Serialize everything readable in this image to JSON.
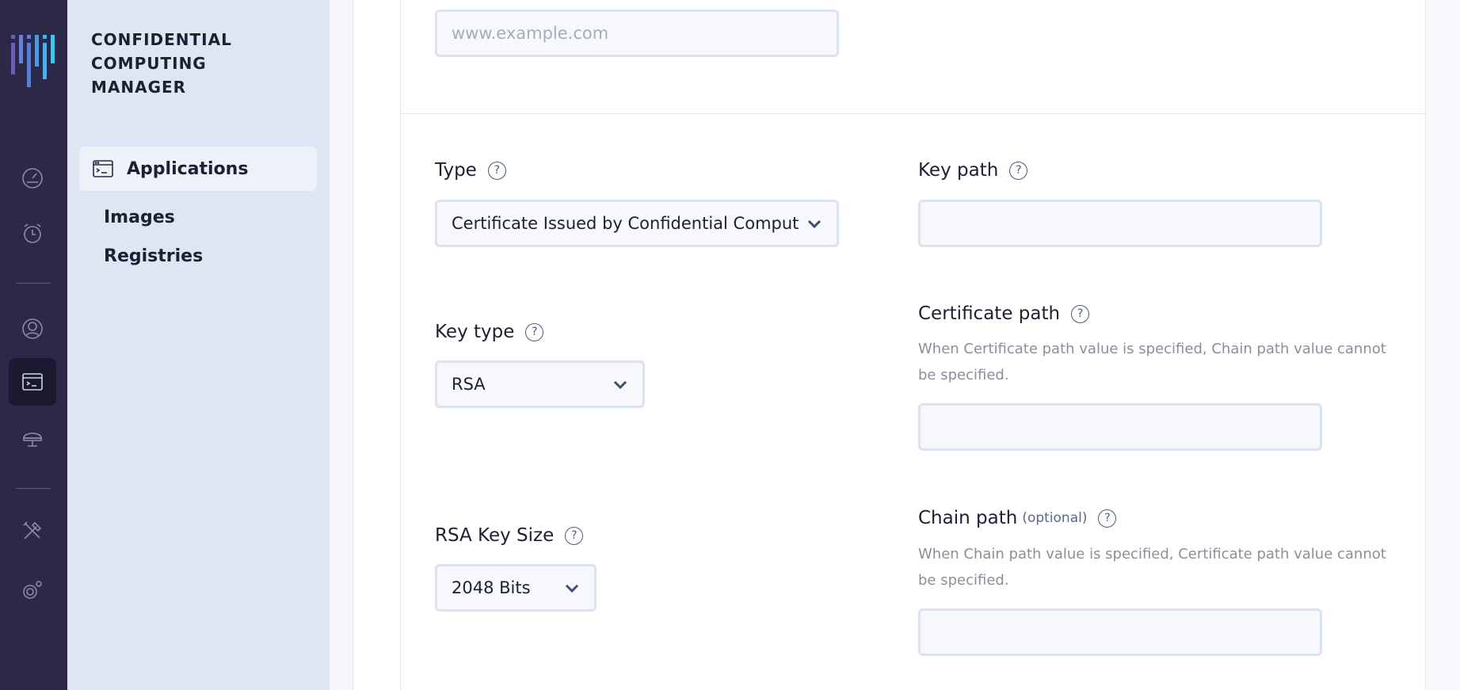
{
  "brand": {
    "line1": "CONFIDENTIAL",
    "line2": "COMPUTING",
    "line3": "MANAGER"
  },
  "rail_icons": [
    "dashboard-icon",
    "alarm-icon",
    "user-support-icon",
    "terminal-icon",
    "router-icon",
    "tools-icon",
    "settings-icon"
  ],
  "nav": {
    "items": [
      {
        "label": "Applications",
        "active": true
      },
      {
        "label": "Images"
      },
      {
        "label": "Registries"
      }
    ]
  },
  "form": {
    "url_field": {
      "placeholder": "www.example.com",
      "value": ""
    },
    "type": {
      "label": "Type",
      "value": "Certificate Issued by Confidential Comput"
    },
    "key_path": {
      "label": "Key path",
      "value": ""
    },
    "key_type": {
      "label": "Key type",
      "value": "RSA"
    },
    "certificate_path": {
      "label": "Certificate path",
      "hint": "When Certificate path value is specified, Chain path value cannot be specified.",
      "value": ""
    },
    "rsa_key_size": {
      "label": "RSA Key Size",
      "value": "2048 Bits"
    },
    "chain_path": {
      "label": "Chain path",
      "optional": "(optional)",
      "hint": "When Chain path value is specified, Certificate path value cannot be specified.",
      "value": ""
    }
  },
  "colors": {
    "rail": "#2c2848",
    "nav": "#dfe6f3",
    "accent": "#5e8ee6"
  }
}
